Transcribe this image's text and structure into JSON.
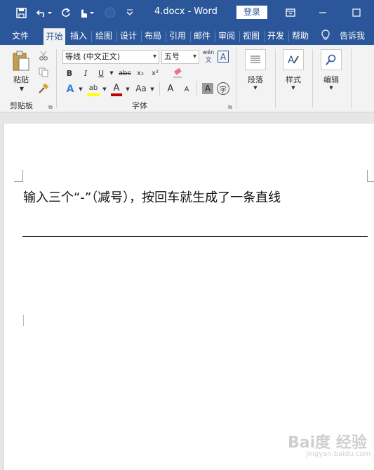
{
  "title_bar": {
    "doc_title": "4.docx  -  Word",
    "login_label": "登录"
  },
  "tabs": [
    "文件",
    "开始",
    "插入",
    "绘图",
    "设计",
    "布局",
    "引用",
    "邮件",
    "审阅",
    "视图",
    "开发",
    "帮助",
    "告诉我"
  ],
  "active_tab": "开始",
  "ribbon": {
    "clipboard": {
      "paste_label": "粘贴",
      "group_label": "剪贴板"
    },
    "font": {
      "font_name": "等线 (中文正文)",
      "font_size": "五号",
      "phonetic_top": "wén",
      "phonetic_bottom": "文",
      "bold": "B",
      "italic": "I",
      "underline": "U",
      "strike": "abc",
      "subscript": "x₂",
      "superscript": "x²",
      "effects": "A",
      "highlight": "ab",
      "font_color": "A",
      "case": "Aa",
      "grow": "A",
      "shrink": "A",
      "char_shading": "A",
      "enclose": "字",
      "group_label": "字体"
    },
    "paragraph": {
      "label": "段落"
    },
    "styles": {
      "label": "样式"
    },
    "editing": {
      "label": "编辑"
    }
  },
  "document": {
    "text": "输入三个“-”（减号），按回车就生成了一条直线"
  },
  "watermark": {
    "brand": "Bai度 经验",
    "sub": "jingyan.baidu.com"
  },
  "colors": {
    "accent": "#2b579a",
    "highlight": "#ffff00",
    "font_color": "#c00000"
  }
}
